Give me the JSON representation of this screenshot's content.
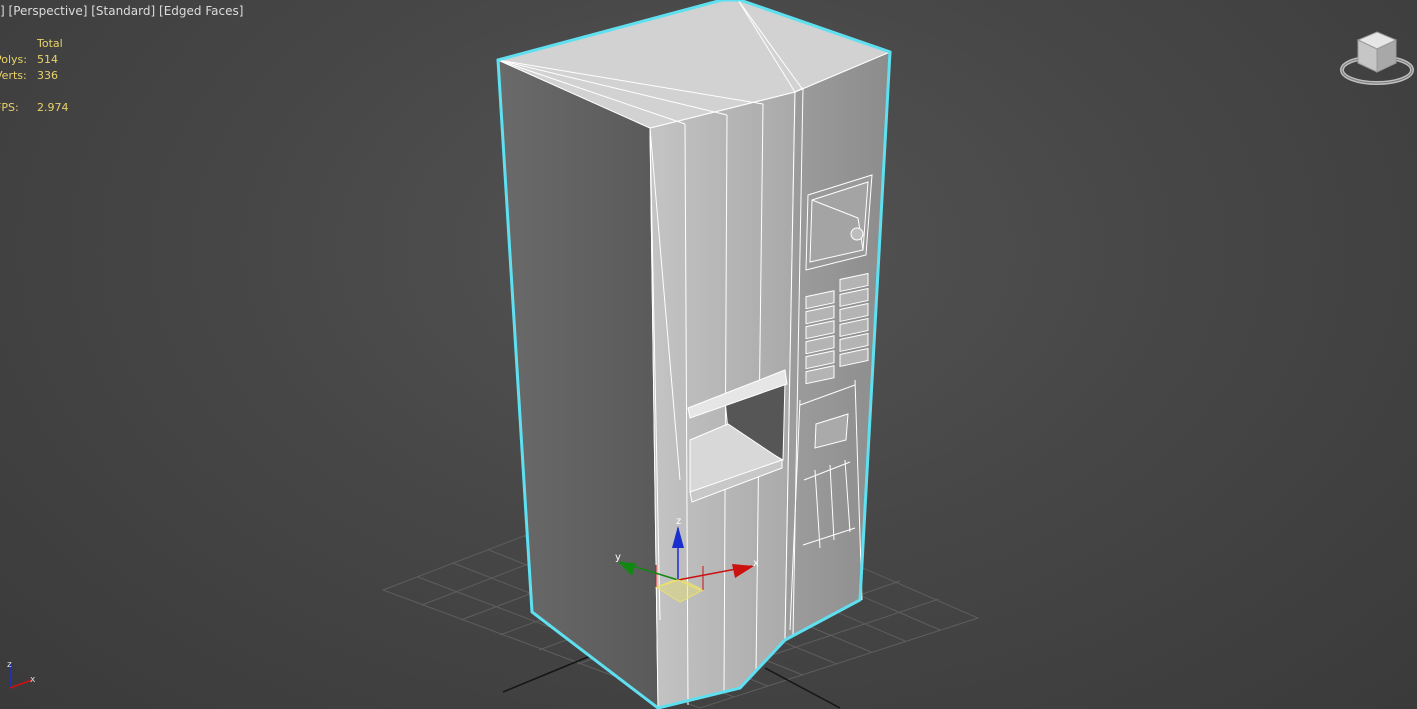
{
  "viewport": {
    "label_parts": [
      "]",
      "[Perspective]",
      "[Standard]",
      "[Edged Faces]"
    ]
  },
  "stats": {
    "header": "Total",
    "polys_label": "Polys:",
    "polys_value": "514",
    "verts_label": "Verts:",
    "verts_value": "336",
    "fps_label": "FPS:",
    "fps_value": "2.974"
  },
  "gizmo": {
    "z_label": "z",
    "y_label": "y",
    "x_label": "x"
  },
  "corner_axis": {
    "z_label": "z",
    "x_label": "x"
  },
  "colors": {
    "background": "#4a4a4a",
    "stats_text": "#e9d26a",
    "selection_outline": "#5fe0f0",
    "axis_x": "#cc1111",
    "axis_y": "#118811",
    "axis_z": "#1a2ed0",
    "plane": "#e8e070"
  },
  "icons": [
    "viewcube-icon",
    "steering-ring-icon"
  ]
}
